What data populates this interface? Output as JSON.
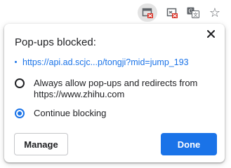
{
  "toolbar": {
    "icons": [
      "popup-blocked-icon",
      "blocked-content-icon",
      "translate-icon",
      "bookmark-star-icon"
    ],
    "star_glyph": "☆"
  },
  "dialog": {
    "title": "Pop-ups blocked:",
    "blocked_url": "https://api.ad.scjc...p/tongji?mid=jump_193",
    "options": [
      {
        "label": "Always allow pop-ups and redirects from https://www.zhihu.com",
        "selected": false
      },
      {
        "label": "Continue blocking",
        "selected": true
      }
    ],
    "manage_label": "Manage",
    "done_label": "Done"
  },
  "colors": {
    "accent": "#1a73e8",
    "blocked_red": "#d93025",
    "text": "#202124"
  }
}
